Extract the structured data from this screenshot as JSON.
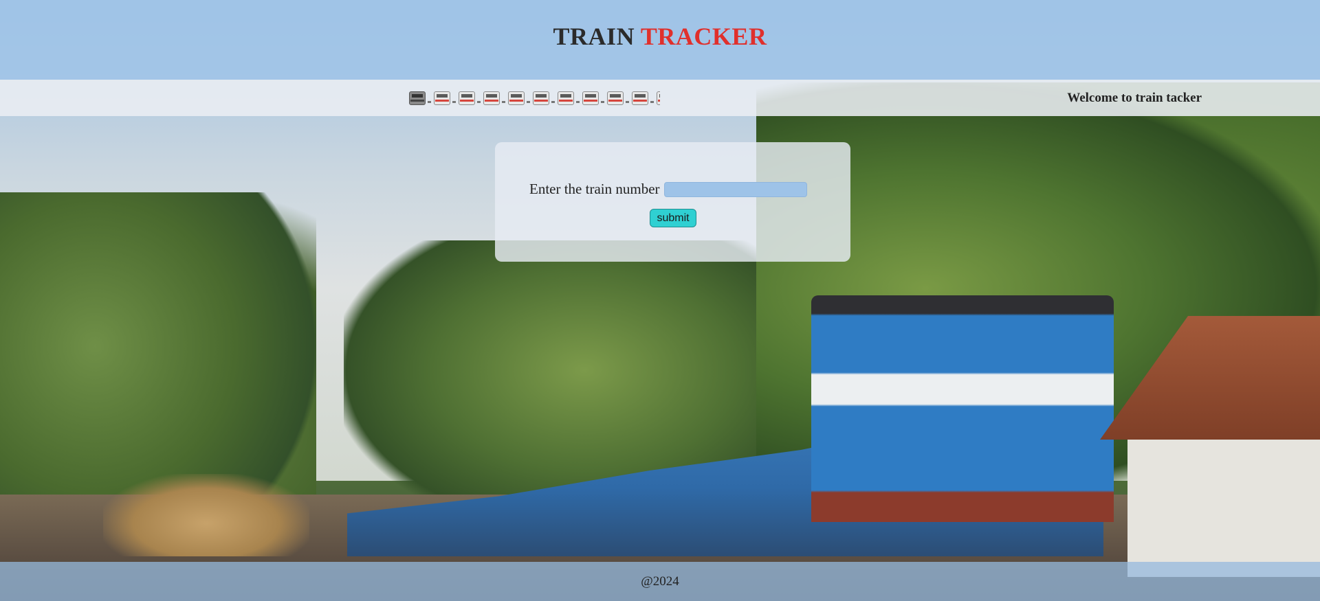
{
  "header": {
    "title_part1": "TRAIN",
    "title_part2": "TRACKER",
    "title_colors": {
      "part1": "#2b2b2b",
      "part2": "#e0302c"
    }
  },
  "navbar": {
    "marquee_icon": "train-icon",
    "welcome_text": "Welcome to train tacker"
  },
  "form": {
    "label": "Enter the train number",
    "input_value": "",
    "submit_label": "submit"
  },
  "footer": {
    "text": "@2024"
  },
  "colors": {
    "header_bg": "#a0c4e8",
    "input_bg": "#9ec3e8",
    "submit_bg": "#2fd0d2",
    "accent_red": "#e0302c"
  }
}
